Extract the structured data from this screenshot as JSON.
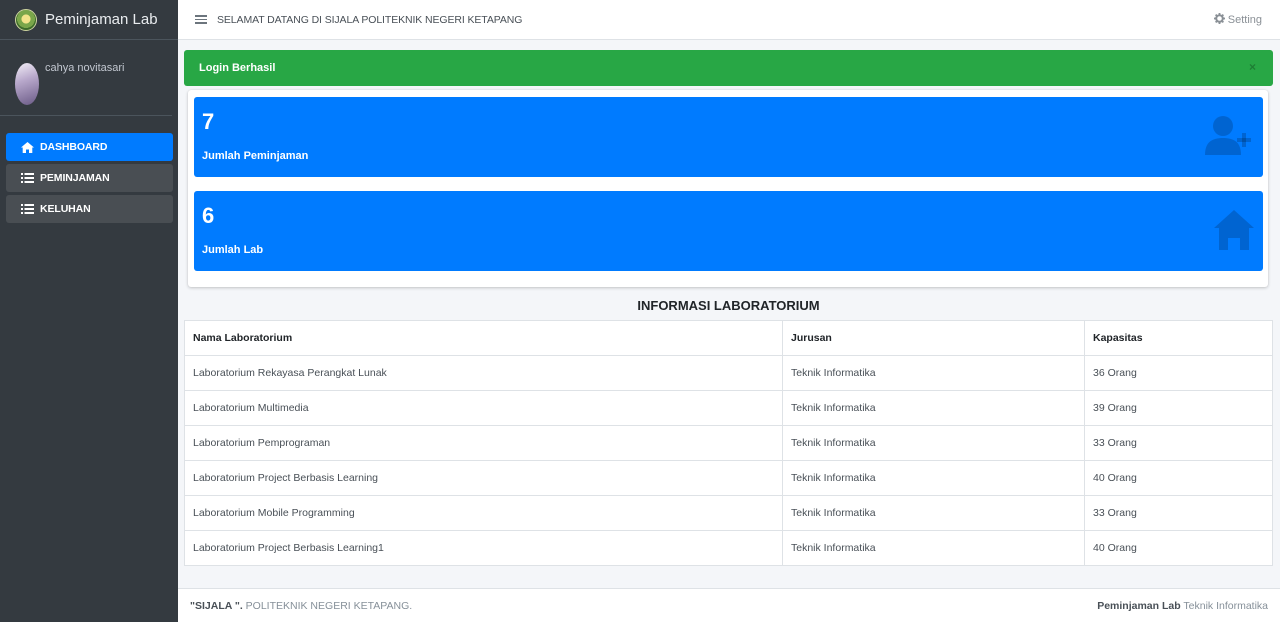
{
  "sidebar": {
    "brand": "Peminjaman Lab",
    "user_name": "cahya novitasari",
    "items": [
      {
        "label": "DASHBOARD",
        "icon": "home-icon",
        "active": true
      },
      {
        "label": "PEMINJAMAN",
        "icon": "list-icon",
        "active": false
      },
      {
        "label": "KELUHAN",
        "icon": "list-icon",
        "active": false
      }
    ]
  },
  "header": {
    "welcome": "SELAMAT DATANG DI SIJALA POLITEKNIK NEGERI KETAPANG",
    "setting": "Setting"
  },
  "alert": {
    "text": "Login Berhasil",
    "close": "×"
  },
  "stats": [
    {
      "value": "7",
      "label": "Jumlah Peminjaman",
      "icon": "user-plus-icon"
    },
    {
      "value": "6",
      "label": "Jumlah Lab",
      "icon": "home-icon"
    }
  ],
  "table": {
    "title": "INFORMASI LABORATORIUM",
    "headers": [
      "Nama Laboratorium",
      "Jurusan",
      "Kapasitas"
    ],
    "rows": [
      [
        "Laboratorium Rekayasa Perangkat Lunak",
        "Teknik Informatika",
        "36 Orang"
      ],
      [
        "Laboratorium Multimedia",
        "Teknik Informatika",
        "39 Orang"
      ],
      [
        "Laboratorium Pemprograman",
        "Teknik Informatika",
        "33 Orang"
      ],
      [
        "Laboratorium Project Berbasis Learning",
        "Teknik Informatika",
        "40 Orang"
      ],
      [
        "Laboratorium Mobile Programming",
        "Teknik Informatika",
        "33 Orang"
      ],
      [
        "Laboratorium Project Berbasis Learning1",
        "Teknik Informatika",
        "40 Orang"
      ]
    ]
  },
  "footer": {
    "left_bold": "\"SIJALA \".",
    "left_text": " POLITEKNIK NEGERI KETAPANG.",
    "right_bold": "Peminjaman Lab",
    "right_text": " Teknik Informatika"
  },
  "colors": {
    "sidebar": "#343a40",
    "primary": "#007bff",
    "success": "#28a745"
  }
}
